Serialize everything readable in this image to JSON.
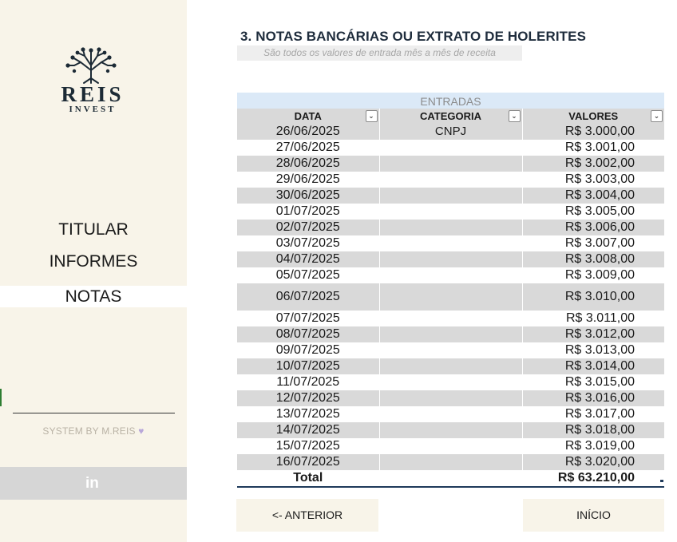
{
  "brand": {
    "name": "REIS",
    "tagline": "INVEST"
  },
  "nav": {
    "items": [
      {
        "label": "TITULAR"
      },
      {
        "label": "INFORMES"
      },
      {
        "label": "NOTAS",
        "active": true
      }
    ]
  },
  "footer": {
    "credit": "SYSTEM BY M.REIS",
    "credit_icon": "purple-heart",
    "social_icon": "linkedin",
    "social_label": "in"
  },
  "page": {
    "title": "3. NOTAS BANCÁRIAS OU EXTRATO DE HOLERITES",
    "subtitle": "São todos os valores de entrada mês a mês de receita"
  },
  "table": {
    "group_header": "ENTRADAS",
    "columns": [
      "DATA",
      "CATEGORIA",
      "VALORES"
    ],
    "filter_glyph": "⌄",
    "rows": [
      {
        "data": "26/06/2025",
        "categoria": "CNPJ",
        "valor": "R$ 3.000,00"
      },
      {
        "data": "27/06/2025",
        "categoria": "",
        "valor": "R$ 3.001,00"
      },
      {
        "data": "28/06/2025",
        "categoria": "",
        "valor": "R$ 3.002,00"
      },
      {
        "data": "29/06/2025",
        "categoria": "",
        "valor": "R$ 3.003,00"
      },
      {
        "data": "30/06/2025",
        "categoria": "",
        "valor": "R$ 3.004,00"
      },
      {
        "data": "01/07/2025",
        "categoria": "",
        "valor": "R$ 3.005,00"
      },
      {
        "data": "02/07/2025",
        "categoria": "",
        "valor": "R$ 3.006,00"
      },
      {
        "data": "03/07/2025",
        "categoria": "",
        "valor": "R$ 3.007,00"
      },
      {
        "data": "04/07/2025",
        "categoria": "",
        "valor": "R$ 3.008,00"
      },
      {
        "data": "05/07/2025",
        "categoria": "",
        "valor": "R$ 3.009,00"
      },
      {
        "data": "06/07/2025",
        "categoria": "",
        "valor": "R$ 3.010,00"
      },
      {
        "data": "07/07/2025",
        "categoria": "",
        "valor": "R$ 3.011,00"
      },
      {
        "data": "08/07/2025",
        "categoria": "",
        "valor": "R$ 3.012,00"
      },
      {
        "data": "09/07/2025",
        "categoria": "",
        "valor": "R$ 3.013,00"
      },
      {
        "data": "10/07/2025",
        "categoria": "",
        "valor": "R$ 3.014,00"
      },
      {
        "data": "11/07/2025",
        "categoria": "",
        "valor": "R$ 3.015,00"
      },
      {
        "data": "12/07/2025",
        "categoria": "",
        "valor": "R$ 3.016,00"
      },
      {
        "data": "13/07/2025",
        "categoria": "",
        "valor": "R$ 3.017,00"
      },
      {
        "data": "14/07/2025",
        "categoria": "",
        "valor": "R$ 3.018,00"
      },
      {
        "data": "15/07/2025",
        "categoria": "",
        "valor": "R$ 3.019,00"
      },
      {
        "data": "16/07/2025",
        "categoria": "",
        "valor": "R$ 3.020,00"
      }
    ],
    "total": {
      "label": "Total",
      "valor": "R$ 63.210,00"
    }
  },
  "buttons": {
    "prev_label": "<- ANTERIOR",
    "home_label": "INÍCIO"
  },
  "colors": {
    "sidebar_bg": "#f8f4e9",
    "header_blue": "#dbe9f7",
    "row_gray": "#d9d9d9",
    "title_navy": "#1f2d3d"
  }
}
